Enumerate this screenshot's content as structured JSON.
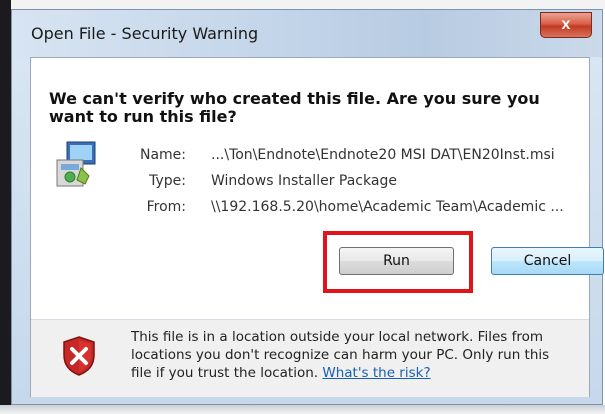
{
  "window": {
    "title": "Open File - Security Warning",
    "close_label": "x"
  },
  "warning": {
    "headline": "We can't verify who created this file. Are you sure you want to run this file?"
  },
  "file": {
    "name_label": "Name:",
    "name_value": "...\\Ton\\Endnote\\Endnote20 MSI DAT\\EN20Inst.msi",
    "type_label": "Type:",
    "type_value": "Windows Installer Package",
    "from_label": "From:",
    "from_value": "\\\\192.168.5.20\\home\\Academic Team\\Academic ..."
  },
  "buttons": {
    "run": "Run",
    "cancel": "Cancel"
  },
  "footer": {
    "message": "This file is in a location outside your local network. Files from locations you don't recognize can harm your PC. Only run this file if you trust the location.",
    "risk_link": "What's the risk?"
  },
  "colors": {
    "highlight": "#e0141b",
    "link": "#1a5fb4",
    "close": "#c13b22"
  },
  "icons": {
    "file": "installer-package-icon",
    "warning": "red-shield-x-icon"
  }
}
